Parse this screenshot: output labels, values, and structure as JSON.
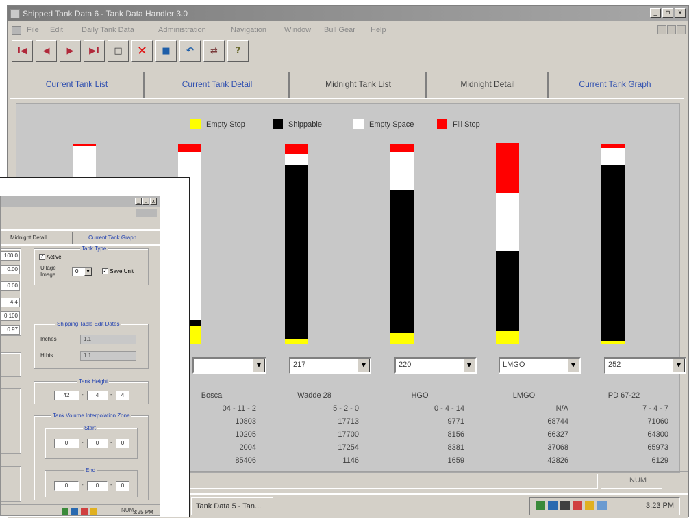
{
  "main": {
    "title": "Shipped Tank Data 6 - Tank Data Handler 3.0",
    "menu": [
      "File",
      "Edit",
      "Daily Tank Data",
      "Administration",
      "Navigation",
      "Window",
      "Bull Gear",
      "Help"
    ],
    "toolbar": [
      "first",
      "prev",
      "next",
      "last",
      "new",
      "delete",
      "save",
      "undo",
      "exit",
      "help"
    ],
    "toolbar_glyphs": [
      "I◀",
      "◀",
      "▶",
      "▶I",
      "□",
      "✕",
      "■",
      "↶",
      "⇄",
      "?"
    ],
    "tabs": [
      "Current Tank List",
      "Current Tank Detail",
      "Midnight Tank List",
      "Midnight Detail",
      "Current Tank Graph"
    ],
    "active_tab": "Current Tank Graph",
    "legend": [
      {
        "label": "Empty Stop",
        "color": "#ffff00"
      },
      {
        "label": "Shippable",
        "color": "#000000"
      },
      {
        "label": "Empty Space",
        "color": "#ffffff"
      },
      {
        "label": "Fill Stop",
        "color": "#ff0000"
      }
    ],
    "selectors": [
      "",
      "217",
      "220",
      "LMGO",
      "252"
    ],
    "table_columns": [
      {
        "values": [
          "Bosca",
          "04 - 11 - 2",
          "10803",
          "10205",
          "2004",
          "85406"
        ]
      },
      {
        "values": [
          "Wadde 28",
          "5 - 2 - 0",
          "17713",
          "17700",
          "17254",
          "1146"
        ]
      },
      {
        "values": [
          "HGO",
          "0 - 4 - 14",
          "9771",
          "8156",
          "8381",
          "1659"
        ]
      },
      {
        "values": [
          "LMGO",
          "N/A",
          "68744",
          "66327",
          "37068",
          "42826"
        ]
      },
      {
        "values": [
          "PD 67-22",
          "7 - 4 - 7",
          "71060",
          "64300",
          "65973",
          "6129"
        ]
      }
    ],
    "status_num": "NUM",
    "taskbar_task": "Tank Data 5 - Tan...",
    "clock": "3:23 PM"
  },
  "chart_data": {
    "type": "bar",
    "title": "",
    "stacked": true,
    "orientation": "vertical",
    "bars": [
      {
        "selector": "",
        "empty_stop": 0,
        "shippable": 0,
        "empty_space": 100,
        "fill_stop": 1
      },
      {
        "selector": "",
        "empty_stop": 9,
        "shippable": 3,
        "empty_space": 84,
        "fill_stop": 4
      },
      {
        "selector": "217",
        "empty_stop": 2.5,
        "shippable": 87,
        "empty_space": 5.5,
        "fill_stop": 5
      },
      {
        "selector": "220",
        "empty_stop": 5,
        "shippable": 72,
        "empty_space": 19,
        "fill_stop": 4
      },
      {
        "selector": "LMGO",
        "empty_stop": 6,
        "shippable": 40,
        "empty_space": 29,
        "fill_stop": 25
      },
      {
        "selector": "252",
        "empty_stop": 1.5,
        "shippable": 88,
        "empty_space": 8.5,
        "fill_stop": 2
      }
    ],
    "series": [
      {
        "name": "Empty Stop"
      },
      {
        "name": "Shippable"
      },
      {
        "name": "Empty Space"
      },
      {
        "name": "Fill Stop"
      }
    ]
  },
  "inset": {
    "tabs": [
      "Midnight Detail",
      "Current Tank Graph"
    ],
    "left_values": [
      "100.0",
      "0.00",
      "0.00",
      "4.4",
      "0.100",
      "0.97"
    ],
    "tank_type": {
      "title": "Tank Type",
      "active_label": "Active",
      "ullage_label": "Ullage",
      "image_label": "Image",
      "ullage_value": "0",
      "save_unit_label": "Save Unit"
    },
    "shipping": {
      "title": "Shipping Table Edit Dates",
      "inches_label": "Inches",
      "inches_value": "1.1",
      "hthis_label": "Hthis",
      "hthis_value": "1.1"
    },
    "tank_height": {
      "title": "Tank Height",
      "values": [
        "42",
        "4",
        "4"
      ]
    },
    "volume_zone": {
      "title": "Tank Volume Interpolation Zone",
      "start_label": "Start",
      "start_values": [
        "0",
        "0",
        "0"
      ],
      "end_label": "End",
      "end_values": [
        "0",
        "0",
        "0"
      ]
    },
    "status_num": "NUM",
    "clock": "3:25 PM"
  }
}
